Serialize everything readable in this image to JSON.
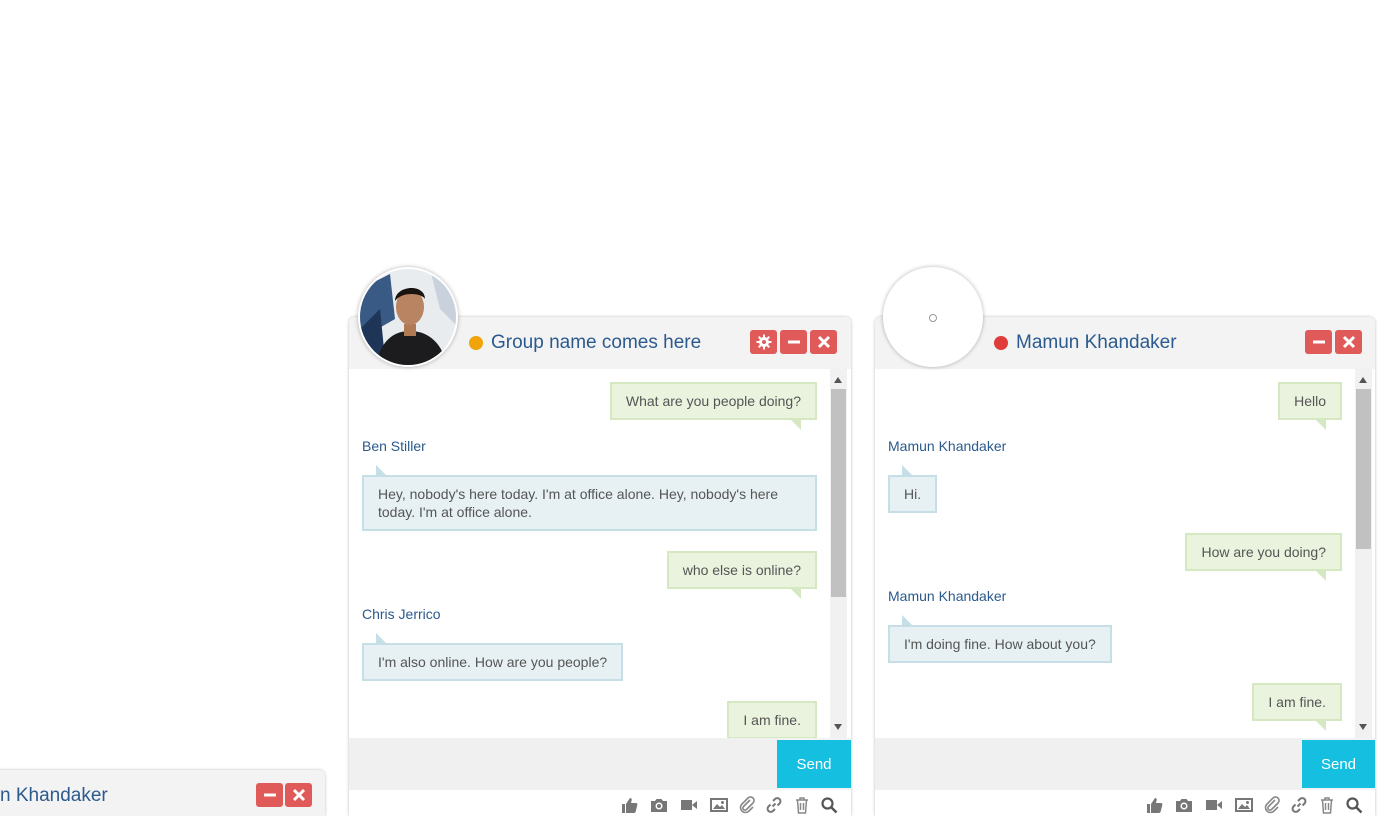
{
  "windows": [
    {
      "title": "Group name comes here",
      "status_color": "#f0a30a",
      "buttons": [
        "gear-icon",
        "minimize-icon",
        "close-icon"
      ],
      "messages": [
        {
          "type": "out",
          "text": "What are you people doing?"
        },
        {
          "type": "in",
          "sender": "Ben Stiller",
          "text": "Hey, nobody's here today. I'm at office alone. Hey, nobody's here today. I'm at office alone."
        },
        {
          "type": "out",
          "text": "who else is online?"
        },
        {
          "type": "in",
          "sender": "Chris Jerrico",
          "text": "I'm also online. How are you people?"
        },
        {
          "type": "out",
          "text": "I am fine."
        }
      ],
      "send_label": "Send"
    },
    {
      "title": "Mamun Khandaker",
      "status_color": "#e03c3c",
      "buttons": [
        "minimize-icon",
        "close-icon"
      ],
      "messages": [
        {
          "type": "out",
          "text": "Hello"
        },
        {
          "type": "in",
          "sender": "Mamun Khandaker",
          "text": "Hi."
        },
        {
          "type": "out",
          "text": "How are you doing?"
        },
        {
          "type": "in",
          "sender": "Mamun Khandaker",
          "text": "I'm doing fine. How about you?"
        },
        {
          "type": "out",
          "text": "I am fine."
        }
      ],
      "send_label": "Send"
    }
  ],
  "minimized_window": {
    "title": "n Khandaker",
    "buttons": [
      "minimize-icon",
      "close-icon"
    ]
  },
  "toolbar_icons": [
    "thumbs-up-icon",
    "camera-icon",
    "video-icon",
    "image-icon",
    "paperclip-icon",
    "link-icon",
    "trash-icon",
    "search-icon"
  ],
  "colors": {
    "accent_send": "#15bfe0",
    "header_button": "#e05a5a",
    "title": "#2b5a8e"
  }
}
